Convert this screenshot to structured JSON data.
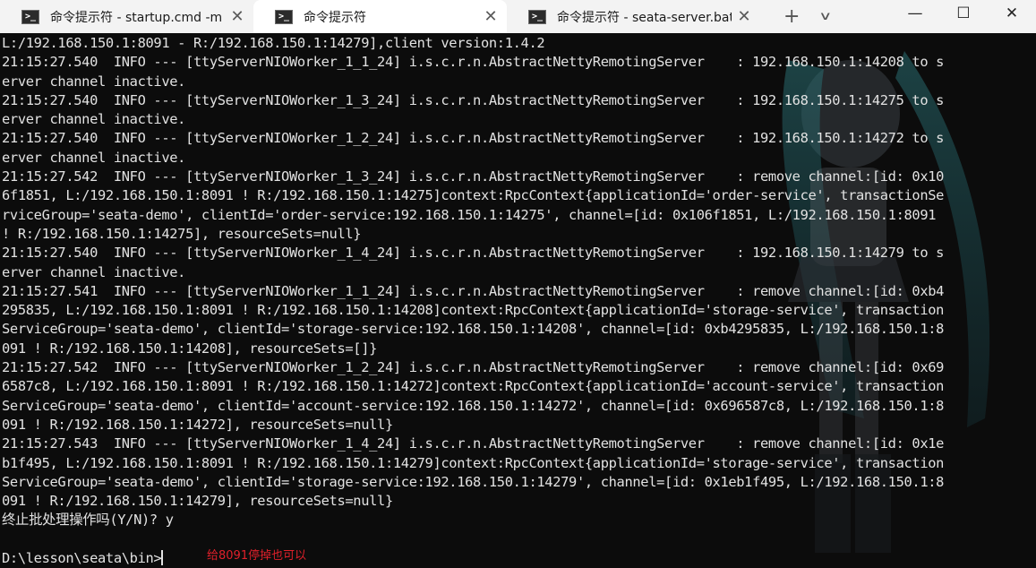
{
  "tabs": [
    {
      "title": "命令提示符 - startup.cmd  -m",
      "icon": "terminal-icon",
      "active": false
    },
    {
      "title": "命令提示符",
      "icon": "terminal-icon",
      "active": true
    },
    {
      "title": "命令提示符 - seata-server.bat",
      "icon": "terminal-icon",
      "active": false
    }
  ],
  "tab_close_glyph": "✕",
  "new_tab_glyph": "+",
  "dropdown_glyph": "∨",
  "window_controls": {
    "minimize": "—",
    "maximize": "☐",
    "close": "✕"
  },
  "console": {
    "background": "#0c0c0c",
    "foreground": "#e2e2e2",
    "lines": [
      "L:/192.168.150.1:8091 - R:/192.168.150.1:14279],client version:1.4.2",
      "21:15:27.540  INFO --- [ttyServerNIOWorker_1_1_24] i.s.c.r.n.AbstractNettyRemotingServer    : 192.168.150.1:14208 to s",
      "erver channel inactive.",
      "21:15:27.540  INFO --- [ttyServerNIOWorker_1_3_24] i.s.c.r.n.AbstractNettyRemotingServer    : 192.168.150.1:14275 to s",
      "erver channel inactive.",
      "21:15:27.540  INFO --- [ttyServerNIOWorker_1_2_24] i.s.c.r.n.AbstractNettyRemotingServer    : 192.168.150.1:14272 to s",
      "erver channel inactive.",
      "21:15:27.542  INFO --- [ttyServerNIOWorker_1_3_24] i.s.c.r.n.AbstractNettyRemotingServer    : remove channel:[id: 0x10",
      "6f1851, L:/192.168.150.1:8091 ! R:/192.168.150.1:14275]context:RpcContext{applicationId='order-service', transactionSe",
      "rviceGroup='seata-demo', clientId='order-service:192.168.150.1:14275', channel=[id: 0x106f1851, L:/192.168.150.1:8091",
      "! R:/192.168.150.1:14275], resourceSets=null}",
      "21:15:27.540  INFO --- [ttyServerNIOWorker_1_4_24] i.s.c.r.n.AbstractNettyRemotingServer    : 192.168.150.1:14279 to s",
      "erver channel inactive.",
      "21:15:27.541  INFO --- [ttyServerNIOWorker_1_1_24] i.s.c.r.n.AbstractNettyRemotingServer    : remove channel:[id: 0xb4",
      "295835, L:/192.168.150.1:8091 ! R:/192.168.150.1:14208]context:RpcContext{applicationId='storage-service', transaction",
      "ServiceGroup='seata-demo', clientId='storage-service:192.168.150.1:14208', channel=[id: 0xb4295835, L:/192.168.150.1:8",
      "091 ! R:/192.168.150.1:14208], resourceSets=[]}",
      "21:15:27.542  INFO --- [ttyServerNIOWorker_1_2_24] i.s.c.r.n.AbstractNettyRemotingServer    : remove channel:[id: 0x69",
      "6587c8, L:/192.168.150.1:8091 ! R:/192.168.150.1:14272]context:RpcContext{applicationId='account-service', transaction",
      "ServiceGroup='seata-demo', clientId='account-service:192.168.150.1:14272', channel=[id: 0x696587c8, L:/192.168.150.1:8",
      "091 ! R:/192.168.150.1:14272], resourceSets=null}",
      "21:15:27.543  INFO --- [ttyServerNIOWorker_1_4_24] i.s.c.r.n.AbstractNettyRemotingServer    : remove channel:[id: 0x1e",
      "b1f495, L:/192.168.150.1:8091 ! R:/192.168.150.1:14279]context:RpcContext{applicationId='storage-service', transaction",
      "ServiceGroup='seata-demo', clientId='storage-service:192.168.150.1:14279', channel=[id: 0x1eb1f495, L:/192.168.150.1:8",
      "091 ! R:/192.168.150.1:14279], resourceSets=null}",
      "终止批处理操作吗(Y/N)? y",
      ""
    ],
    "prompt": "D:\\lesson\\seata\\bin>"
  },
  "annotation": {
    "text": "给8091停掉也可以",
    "color": "#e0202a"
  }
}
